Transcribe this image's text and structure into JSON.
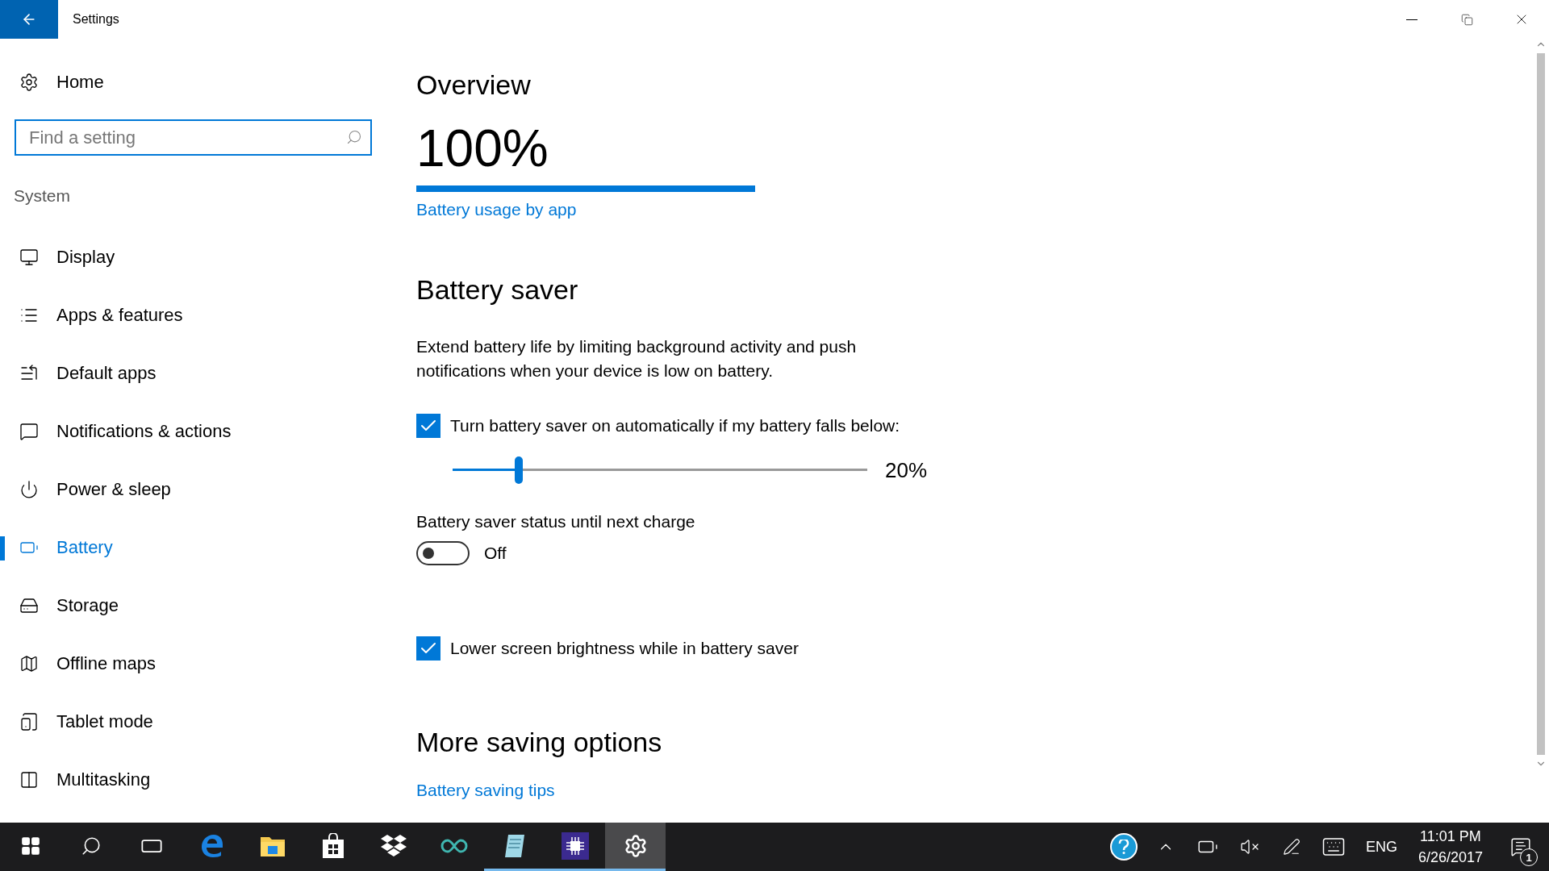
{
  "window": {
    "title": "Settings"
  },
  "sidebar": {
    "home": "Home",
    "search": {
      "placeholder": "Find a setting"
    },
    "section": "System",
    "items": [
      {
        "kind": "display",
        "label": "Display",
        "selected": false
      },
      {
        "kind": "apps",
        "label": "Apps & features",
        "selected": false
      },
      {
        "kind": "default",
        "label": "Default apps",
        "selected": false
      },
      {
        "kind": "notifications",
        "label": "Notifications & actions",
        "selected": false
      },
      {
        "kind": "power",
        "label": "Power & sleep",
        "selected": false
      },
      {
        "kind": "battery",
        "label": "Battery",
        "selected": true
      },
      {
        "kind": "storage",
        "label": "Storage",
        "selected": false
      },
      {
        "kind": "maps",
        "label": "Offline maps",
        "selected": false
      },
      {
        "kind": "tablet",
        "label": "Tablet mode",
        "selected": false
      },
      {
        "kind": "multitask",
        "label": "Multitasking",
        "selected": false
      }
    ]
  },
  "overview": {
    "heading": "Overview",
    "percent": "100%",
    "level": 1,
    "link": "Battery usage by app"
  },
  "battery_saver": {
    "heading": "Battery saver",
    "description": "Extend battery life by limiting background activity and push notifications when your device is low on battery.",
    "auto": {
      "label": "Turn battery saver on automatically if my battery falls below:",
      "checked": true
    },
    "threshold": {
      "level": 0.16,
      "reading": "20%"
    },
    "status": {
      "label": "Battery saver status until next charge",
      "on": false,
      "state": "Off"
    },
    "brightness": {
      "label": "Lower screen brightness while in battery saver",
      "checked": true
    }
  },
  "more": {
    "heading": "More saving options",
    "link": "Battery saving tips"
  },
  "taskbar": {
    "apps": [
      {
        "kind": "browser",
        "running": false,
        "selected": false
      },
      {
        "kind": "folder",
        "running": false,
        "selected": false
      },
      {
        "kind": "store",
        "running": false,
        "selected": false
      },
      {
        "kind": "box",
        "running": false,
        "selected": false
      },
      {
        "kind": "infinity",
        "running": false,
        "selected": false
      },
      {
        "kind": "notepad",
        "running": true,
        "selected": false
      },
      {
        "kind": "chip",
        "running": true,
        "selected": false
      },
      {
        "kind": "gear",
        "running": true,
        "selected": true
      }
    ],
    "language": "ENG",
    "time": "11:01 PM",
    "date": "6/26/2017",
    "notifications": "1"
  }
}
